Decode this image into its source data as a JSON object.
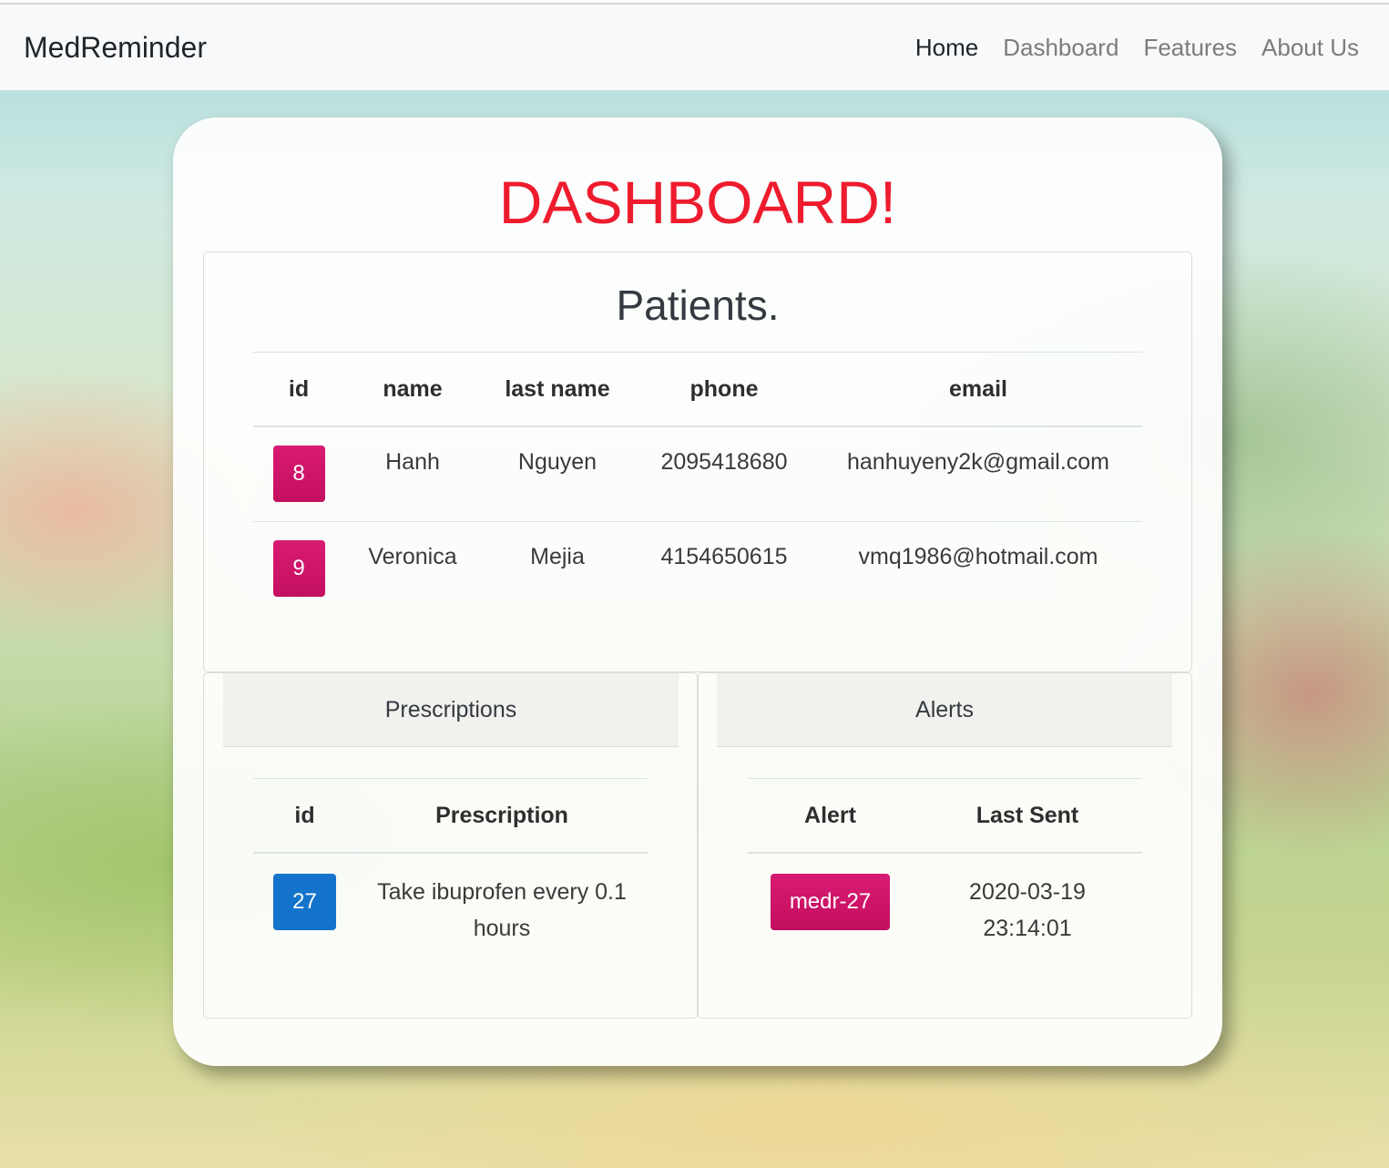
{
  "navbar": {
    "brand": "MedReminder",
    "links": [
      "Home",
      "Dashboard",
      "Features",
      "About Us"
    ],
    "active": "Home"
  },
  "page_title": "DASHBOARD!",
  "patients": {
    "title": "Patients.",
    "columns": [
      "id",
      "name",
      "last name",
      "phone",
      "email"
    ],
    "rows": [
      {
        "id": "8",
        "name": "Hanh",
        "last_name": "Nguyen",
        "phone": "2095418680",
        "email": "hanhuyeny2k@gmail.com"
      },
      {
        "id": "9",
        "name": "Veronica",
        "last_name": "Mejia",
        "phone": "4154650615",
        "email": "vmq1986@hotmail.com"
      }
    ]
  },
  "prescriptions": {
    "header": "Prescriptions",
    "columns": [
      "id",
      "Prescription"
    ],
    "rows": [
      {
        "id": "27",
        "prescription": "Take ibuprofen every 0.1 hours"
      }
    ]
  },
  "alerts": {
    "header": "Alerts",
    "columns": [
      "Alert",
      "Last Sent"
    ],
    "rows": [
      {
        "alert": "medr-27",
        "last_sent": "2020-03-19 23:14:01"
      }
    ]
  },
  "colors": {
    "title_red": "#ee1c2e",
    "badge_pink": "#c90f63",
    "badge_blue": "#1474cc"
  }
}
